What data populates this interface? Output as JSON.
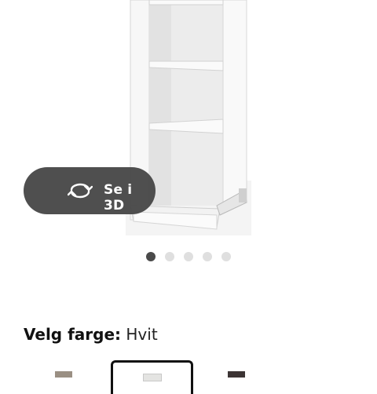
{
  "gallery": {
    "view_3d_label": "Se i 3D",
    "dot_count": 5,
    "active_index": 0
  },
  "color_picker": {
    "prompt": "Velg farge:",
    "selected_color": "Hvit",
    "swatches": [
      {
        "name": "swatch-dark-gray-beige",
        "color": "#9a8f83"
      },
      {
        "name": "swatch-white",
        "color": "#e4e4e2",
        "selected": true
      },
      {
        "name": "swatch-black-brown",
        "color": "#3c3434"
      }
    ]
  },
  "colors": {
    "button_bg": "#484848",
    "active_dot": "#4a4a4a",
    "inactive_dot": "#dfdfdf"
  }
}
